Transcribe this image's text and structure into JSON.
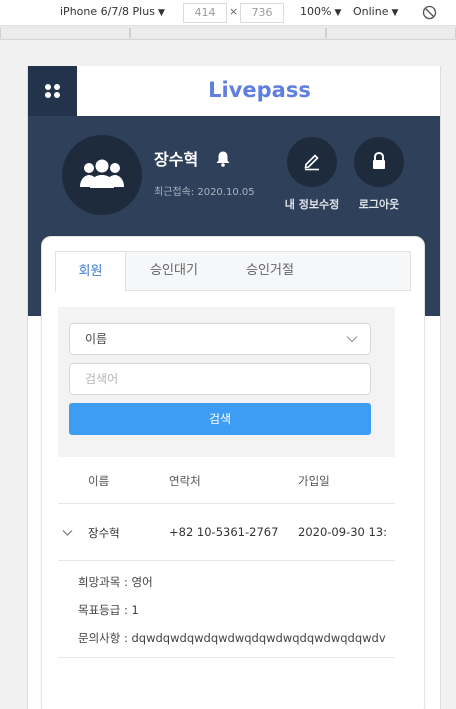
{
  "devtools": {
    "device": "iPhone 6/7/8 Plus",
    "width": "414",
    "height": "736",
    "times": "×",
    "zoom": "100%",
    "network": "Online"
  },
  "app": {
    "brand": "Livepass"
  },
  "profile": {
    "name": "장수혁",
    "last_login": "최근접속: 2020.10.05",
    "edit_label": "내 정보수정",
    "logout_label": "로그아웃"
  },
  "tabs": [
    {
      "label": "회원",
      "active": true
    },
    {
      "label": "승인대기",
      "active": false
    },
    {
      "label": "승인거절",
      "active": false
    }
  ],
  "search": {
    "select_value": "이름",
    "placeholder": "검색어",
    "button_label": "검색"
  },
  "table": {
    "headers": [
      "이름",
      "연락처",
      "가입일"
    ],
    "rows": [
      {
        "name": "장수혁",
        "phone": "+82 10-5361-2767",
        "joined": "2020-09-30 13:",
        "details": [
          "희망과목 : 영어",
          "목표등급 : 1",
          "문의사항 : dqwdqwdqwdqwdwqdqwdwqdqwdwqdqwdv"
        ]
      }
    ]
  },
  "colors": {
    "brand": "#5f7fe0",
    "header_dark": "#2f405a",
    "accent_button": "#3d9cf4",
    "active_tab": "#3a7bd5"
  }
}
